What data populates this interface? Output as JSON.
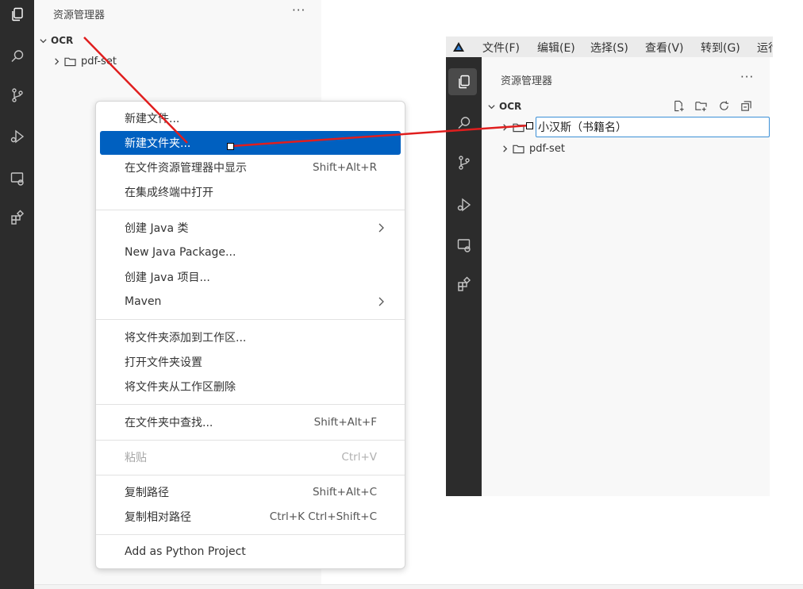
{
  "left_window": {
    "sidebar_title": "资源管理器",
    "more_label": "···",
    "tree": {
      "root": "OCR",
      "child": "pdf-set"
    },
    "activity_icons": [
      "explorer-icon",
      "search-icon",
      "source-control-icon",
      "run-debug-icon",
      "remote-explorer-icon",
      "extensions-icon"
    ]
  },
  "context_menu": {
    "items": [
      {
        "label": "新建文件...",
        "shortcut": "",
        "state": "normal"
      },
      {
        "label": "新建文件夹...",
        "shortcut": "",
        "state": "active"
      },
      {
        "label": "在文件资源管理器中显示",
        "shortcut": "Shift+Alt+R",
        "state": "normal"
      },
      {
        "label": "在集成终端中打开",
        "shortcut": "",
        "state": "normal"
      },
      {
        "label": "创建 Java 类",
        "shortcut": "",
        "state": "submenu"
      },
      {
        "label": "New Java Package...",
        "shortcut": "",
        "state": "normal"
      },
      {
        "label": "创建 Java 项目...",
        "shortcut": "",
        "state": "normal"
      },
      {
        "label": "Maven",
        "shortcut": "",
        "state": "submenu"
      },
      {
        "label": "将文件夹添加到工作区...",
        "shortcut": "",
        "state": "normal"
      },
      {
        "label": "打开文件夹设置",
        "shortcut": "",
        "state": "normal"
      },
      {
        "label": "将文件夹从工作区删除",
        "shortcut": "",
        "state": "normal"
      },
      {
        "label": "在文件夹中查找...",
        "shortcut": "Shift+Alt+F",
        "state": "normal"
      },
      {
        "label": "粘贴",
        "shortcut": "Ctrl+V",
        "state": "disabled"
      },
      {
        "label": "复制路径",
        "shortcut": "Shift+Alt+C",
        "state": "normal"
      },
      {
        "label": "复制相对路径",
        "shortcut": "Ctrl+K Ctrl+Shift+C",
        "state": "normal"
      },
      {
        "label": "Add as Python Project",
        "shortcut": "",
        "state": "normal"
      }
    ]
  },
  "right_window": {
    "menubar": [
      "文件(F)",
      "编辑(E)",
      "选择(S)",
      "查看(V)",
      "转到(G)",
      "运行"
    ],
    "sidebar_title": "资源管理器",
    "more_label": "···",
    "tree": {
      "root": "OCR",
      "new_folder_value": "小汉斯（书籍名）",
      "child": "pdf-set"
    },
    "toolbar_icons": [
      "new-file-icon",
      "new-folder-icon",
      "refresh-icon",
      "collapse-all-icon"
    ]
  },
  "colors": {
    "activity_bar": "#2c2c2c",
    "sidebar_bg": "#f8f8f8",
    "menu_highlight": "#0060c0",
    "annotation_line": "#e01e1e",
    "input_border": "#3b8fd6"
  }
}
